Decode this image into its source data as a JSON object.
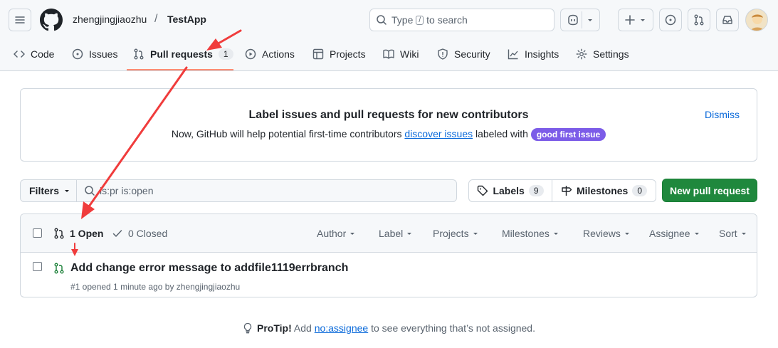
{
  "header": {
    "owner": "zhengjingjiaozhu",
    "separator": "/",
    "repo": "TestApp",
    "search_prefix": "Type",
    "search_key": "/",
    "search_suffix": "to search"
  },
  "tabs": [
    {
      "label": "Code",
      "icon": "code-icon"
    },
    {
      "label": "Issues",
      "icon": "issue-opened-icon"
    },
    {
      "label": "Pull requests",
      "icon": "git-pull-request-icon",
      "count": "1",
      "active": true
    },
    {
      "label": "Actions",
      "icon": "play-icon"
    },
    {
      "label": "Projects",
      "icon": "table-icon"
    },
    {
      "label": "Wiki",
      "icon": "book-icon"
    },
    {
      "label": "Security",
      "icon": "shield-icon"
    },
    {
      "label": "Insights",
      "icon": "graph-icon"
    },
    {
      "label": "Settings",
      "icon": "gear-icon"
    }
  ],
  "banner": {
    "title": "Label issues and pull requests for new contributors",
    "text_before": "Now, GitHub will help potential first-time contributors",
    "link": "discover issues",
    "text_after": "labeled with",
    "label": "good first issue",
    "dismiss": "Dismiss"
  },
  "toolbar": {
    "filters": "Filters",
    "filter_value": "is:pr is:open",
    "labels": "Labels",
    "labels_count": "9",
    "milestones": "Milestones",
    "milestones_count": "0",
    "new_pr": "New pull request"
  },
  "list": {
    "open": "1 Open",
    "closed": "0 Closed",
    "filters": [
      "Author",
      "Label",
      "Projects",
      "Milestones",
      "Reviews",
      "Assignee",
      "Sort"
    ],
    "items": [
      {
        "title": "Add change error message to addfile1119errbranch",
        "meta": "#1 opened 1 minute ago by zhengjingjiaozhu"
      }
    ]
  },
  "protip": {
    "label": "ProTip!",
    "before": "Add",
    "link": "no:assignee",
    "after": "to see everything that’s not assigned."
  },
  "colors": {
    "accent_orange": "#fd8c73",
    "primary_green": "#1f883d",
    "link_blue": "#0969da",
    "label_purple": "#7c5ce8",
    "annotation_red": "#f03c3c"
  }
}
